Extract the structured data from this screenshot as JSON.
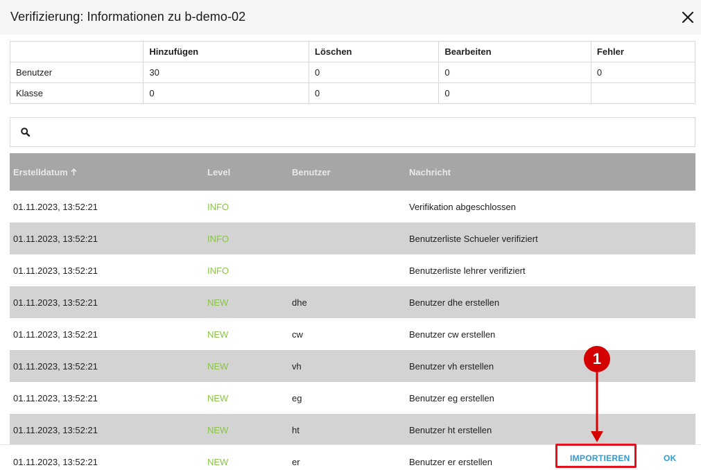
{
  "dialog": {
    "title": "Verifizierung: Informationen zu b-demo-02",
    "close_icon": "close-icon"
  },
  "summary": {
    "headers": [
      "",
      "Hinzufügen",
      "Löschen",
      "Bearbeiten",
      "Fehler"
    ],
    "rows": [
      [
        "Benutzer",
        "30",
        "0",
        "0",
        "0"
      ],
      [
        "Klasse",
        "0",
        "0",
        "0",
        ""
      ]
    ]
  },
  "search": {
    "icon": "search-icon",
    "placeholder": ""
  },
  "log": {
    "columns": [
      "Erstelldatum",
      "Level",
      "Benutzer",
      "Nachricht"
    ],
    "sort_icon": "arrow-up-icon",
    "rows": [
      {
        "date": "01.11.2023, 13:52:21",
        "level": "INFO",
        "user": "",
        "message": "Verifikation abgeschlossen"
      },
      {
        "date": "01.11.2023, 13:52:21",
        "level": "INFO",
        "user": "",
        "message": "Benutzerliste Schueler verifiziert"
      },
      {
        "date": "01.11.2023, 13:52:21",
        "level": "INFO",
        "user": "",
        "message": "Benutzerliste lehrer verifiziert"
      },
      {
        "date": "01.11.2023, 13:52:21",
        "level": "NEW",
        "user": "dhe",
        "message": "Benutzer dhe erstellen"
      },
      {
        "date": "01.11.2023, 13:52:21",
        "level": "NEW",
        "user": "cw",
        "message": "Benutzer cw erstellen"
      },
      {
        "date": "01.11.2023, 13:52:21",
        "level": "NEW",
        "user": "vh",
        "message": "Benutzer vh erstellen"
      },
      {
        "date": "01.11.2023, 13:52:21",
        "level": "NEW",
        "user": "eg",
        "message": "Benutzer eg erstellen"
      },
      {
        "date": "01.11.2023, 13:52:21",
        "level": "NEW",
        "user": "ht",
        "message": "Benutzer ht erstellen"
      }
    ]
  },
  "footer": {
    "last_row": {
      "date": "01.11.2023, 13:52:21",
      "level": "NEW",
      "user": "er",
      "message": "Benutzer er erstellen"
    },
    "import_label": "IMPORTIEREN",
    "ok_label": "OK"
  },
  "annotation": {
    "marker_label": "1",
    "color": "#d50000"
  },
  "colors": {
    "level_text": "#8bc34a",
    "button_text": "#2e9bd3",
    "log_header_bg": "#a6a6a6",
    "row_alt_bg": "#d3d3d3"
  }
}
